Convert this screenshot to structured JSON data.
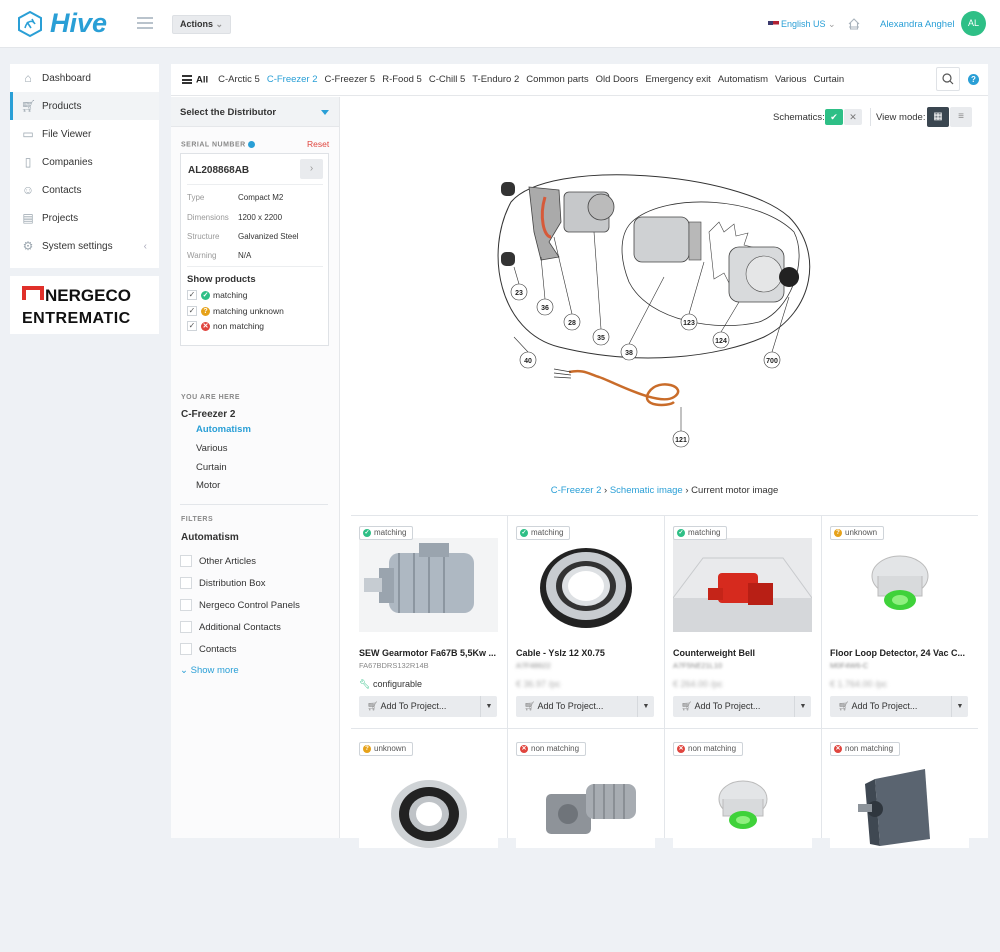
{
  "app": {
    "name": "Hive"
  },
  "header": {
    "actions_label": "Actions",
    "language": "English US",
    "user_name": "Alexandra Anghel",
    "user_initials": "AL"
  },
  "sidebar": {
    "items": [
      {
        "label": "Dashboard",
        "icon": "home-icon"
      },
      {
        "label": "Products",
        "icon": "cart-icon"
      },
      {
        "label": "File Viewer",
        "icon": "file-icon"
      },
      {
        "label": "Companies",
        "icon": "building-icon"
      },
      {
        "label": "Contacts",
        "icon": "contacts-icon"
      },
      {
        "label": "Projects",
        "icon": "projects-icon"
      },
      {
        "label": "System settings",
        "icon": "gear-icon"
      }
    ]
  },
  "brand": {
    "line1": "NERGECO",
    "line2": "ENTREMATIC"
  },
  "tabs": {
    "all_label": "All",
    "items": [
      "C-Arctic 5",
      "C-Freezer 2",
      "C-Freezer 5",
      "R-Food 5",
      "C-Chill 5",
      "T-Enduro 2",
      "Common parts",
      "Old Doors",
      "Emergency exit",
      "Automatism",
      "Various",
      "Curtain"
    ],
    "active": "C-Freezer 2"
  },
  "filters_panel": {
    "distributor_label": "Select the Distributor",
    "serial_label": "SERIAL NUMBER",
    "reset_label": "Reset",
    "serial_value": "AL208868AB",
    "specs": [
      {
        "label": "Type",
        "value": "Compact M2"
      },
      {
        "label": "Dimensions",
        "value": "1200 x 2200"
      },
      {
        "label": "Structure",
        "value": "Galvanized Steel"
      },
      {
        "label": "Warning",
        "value": "N/A"
      }
    ],
    "show_products_label": "Show products",
    "show_options": [
      "matching",
      "matching unknown",
      "non matching"
    ],
    "here_label": "YOU ARE HERE",
    "here_root": "C-Freezer 2",
    "here_items": [
      "Automatism",
      "Various",
      "Curtain",
      "Motor"
    ],
    "filters_label": "FILTERS",
    "filters_title": "Automatism",
    "filter_options": [
      "Other Articles",
      "Distribution Box",
      "Nergeco Control Panels",
      "Additional Contacts",
      "Contacts"
    ],
    "show_more": "Show more"
  },
  "view": {
    "schematics_label": "Schematics:",
    "view_mode_label": "View mode:"
  },
  "diagram_labels": [
    "23",
    "36",
    "28",
    "35",
    "123",
    "124",
    "700",
    "38",
    "40",
    "121"
  ],
  "breadcrumb": {
    "root": "C-Freezer 2",
    "middle": "Schematic image",
    "current": "Current motor image"
  },
  "products": [
    {
      "status": "matching",
      "name": "SEW Gearmotor Fa67B 5,5Kw ...",
      "code": "FA67BDRS132R14B",
      "extra": "configurable",
      "add_label": "Add To Project..."
    },
    {
      "status": "matching",
      "name": "Cable - Yslz 12 X0.75",
      "code": "A7F48622",
      "price": "€ 36.97",
      "unit": "/pc",
      "add_label": "Add To Project..."
    },
    {
      "status": "matching",
      "name": "Counterweight Bell",
      "code": "A7F5NE21L10",
      "price": "€ 264.00",
      "unit": "/pc",
      "add_label": "Add To Project..."
    },
    {
      "status": "unknown",
      "name": "Floor Loop Detector, 24 Vac C...",
      "code": "M0F4W6-C",
      "price": "€ 1.764.00",
      "unit": "/pc",
      "add_label": "Add To Project..."
    },
    {
      "status": "unknown"
    },
    {
      "status": "non matching"
    },
    {
      "status": "non matching"
    },
    {
      "status": "non matching"
    }
  ],
  "colors": {
    "accent": "#2a9fd6",
    "matching": "#2ebf86",
    "unknown": "#e6a21a",
    "non_matching": "#e0453e"
  }
}
